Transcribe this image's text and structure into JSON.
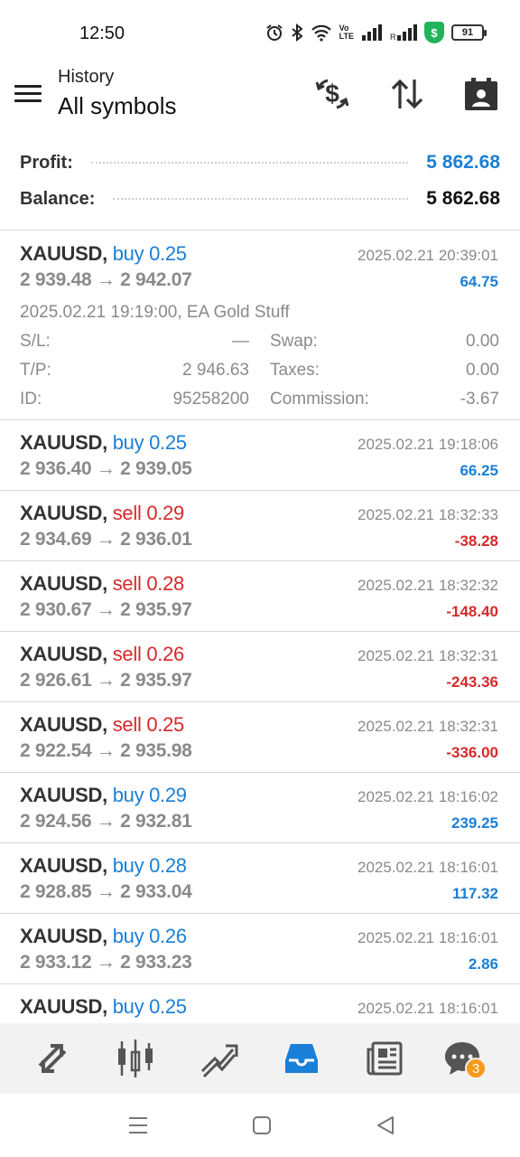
{
  "status_bar": {
    "time": "12:50",
    "icons": [
      "alarm-icon",
      "bluetooth-icon",
      "wifi-icon",
      "volte-icon",
      "signal-icon",
      "signal-r-icon",
      "security-shield-icon"
    ],
    "battery": "91"
  },
  "header": {
    "subtitle": "History",
    "title": "All symbols",
    "actions": [
      "currency-exchange-icon",
      "sort-icon",
      "calendar-icon"
    ]
  },
  "summary": {
    "profit_label": "Profit:",
    "profit_value": "5 862.68",
    "balance_label": "Balance:",
    "balance_value": "5 862.68",
    "profit_color": "#1a7fd6"
  },
  "trades": [
    {
      "symbol": "XAUUSD,",
      "type": "buy 0.25",
      "side": "buy",
      "prices": "2 939.48 → 2 942.07",
      "time": "2025.02.21 20:39:01",
      "profit": "64.75",
      "open_info": "2025.02.21 19:19:00, EA Gold Stuff",
      "sl_label": "S/L:",
      "sl": "—",
      "tp_label": "T/P:",
      "tp": "2 946.63",
      "id_label": "ID:",
      "id": "95258200",
      "swap_label": "Swap:",
      "swap": "0.00",
      "taxes_label": "Taxes:",
      "taxes": "0.00",
      "commission_label": "Commission:",
      "commission": "-3.67"
    },
    {
      "symbol": "XAUUSD,",
      "type": "buy 0.25",
      "side": "buy",
      "prices": "2 936.40 → 2 939.05",
      "time": "2025.02.21 19:18:06",
      "profit": "66.25"
    },
    {
      "symbol": "XAUUSD,",
      "type": "sell 0.29",
      "side": "sell",
      "prices": "2 934.69 → 2 936.01",
      "time": "2025.02.21 18:32:33",
      "profit": "-38.28"
    },
    {
      "symbol": "XAUUSD,",
      "type": "sell 0.28",
      "side": "sell",
      "prices": "2 930.67 → 2 935.97",
      "time": "2025.02.21 18:32:32",
      "profit": "-148.40"
    },
    {
      "symbol": "XAUUSD,",
      "type": "sell 0.26",
      "side": "sell",
      "prices": "2 926.61 → 2 935.97",
      "time": "2025.02.21 18:32:31",
      "profit": "-243.36"
    },
    {
      "symbol": "XAUUSD,",
      "type": "sell 0.25",
      "side": "sell",
      "prices": "2 922.54 → 2 935.98",
      "time": "2025.02.21 18:32:31",
      "profit": "-336.00"
    },
    {
      "symbol": "XAUUSD,",
      "type": "buy 0.29",
      "side": "buy",
      "prices": "2 924.56 → 2 932.81",
      "time": "2025.02.21 18:16:02",
      "profit": "239.25"
    },
    {
      "symbol": "XAUUSD,",
      "type": "buy 0.28",
      "side": "buy",
      "prices": "2 928.85 → 2 933.04",
      "time": "2025.02.21 18:16:01",
      "profit": "117.32"
    },
    {
      "symbol": "XAUUSD,",
      "type": "buy 0.26",
      "side": "buy",
      "prices": "2 933.12 → 2 933.23",
      "time": "2025.02.21 18:16:01",
      "profit": "2.86"
    },
    {
      "symbol": "XAUUSD,",
      "type": "buy 0.25",
      "side": "buy",
      "prices": "",
      "time": "2025.02.21 18:16:01",
      "profit": ""
    }
  ],
  "bottom_nav": {
    "items": [
      "quotes-icon",
      "chart-icon",
      "trade-icon",
      "history-icon",
      "news-icon",
      "chat-icon"
    ],
    "active": "history-icon",
    "active_color": "#1a7fd6",
    "chat_badge": "3"
  },
  "system_nav": [
    "recents-icon",
    "home-icon",
    "back-icon"
  ]
}
